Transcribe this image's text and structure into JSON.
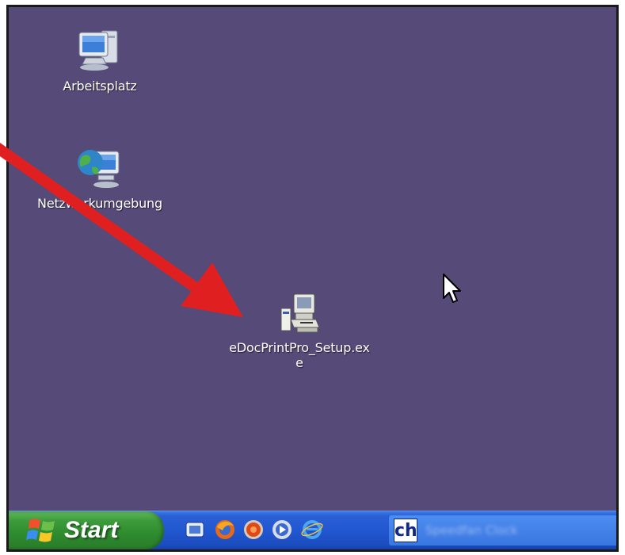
{
  "desktop": {
    "icons": [
      {
        "label": "Arbeitsplatz",
        "icon": "my-computer-icon"
      },
      {
        "label": "Netzwerkumgebung",
        "icon": "network-places-icon"
      },
      {
        "label": "eDocPrintPro_Setup.ex\ne",
        "icon": "setup-installer-icon"
      }
    ],
    "background_color": "#564a78"
  },
  "annotation": {
    "arrow_color": "#e02020"
  },
  "taskbar": {
    "start_label": "Start",
    "quick_launch": [
      "desktop-show-icon",
      "firefox-icon",
      "media-icon",
      "player-icon",
      "internet-explorer-icon"
    ],
    "task_button": {
      "icon_text": "ch",
      "label": "Speedfan Clock"
    }
  }
}
